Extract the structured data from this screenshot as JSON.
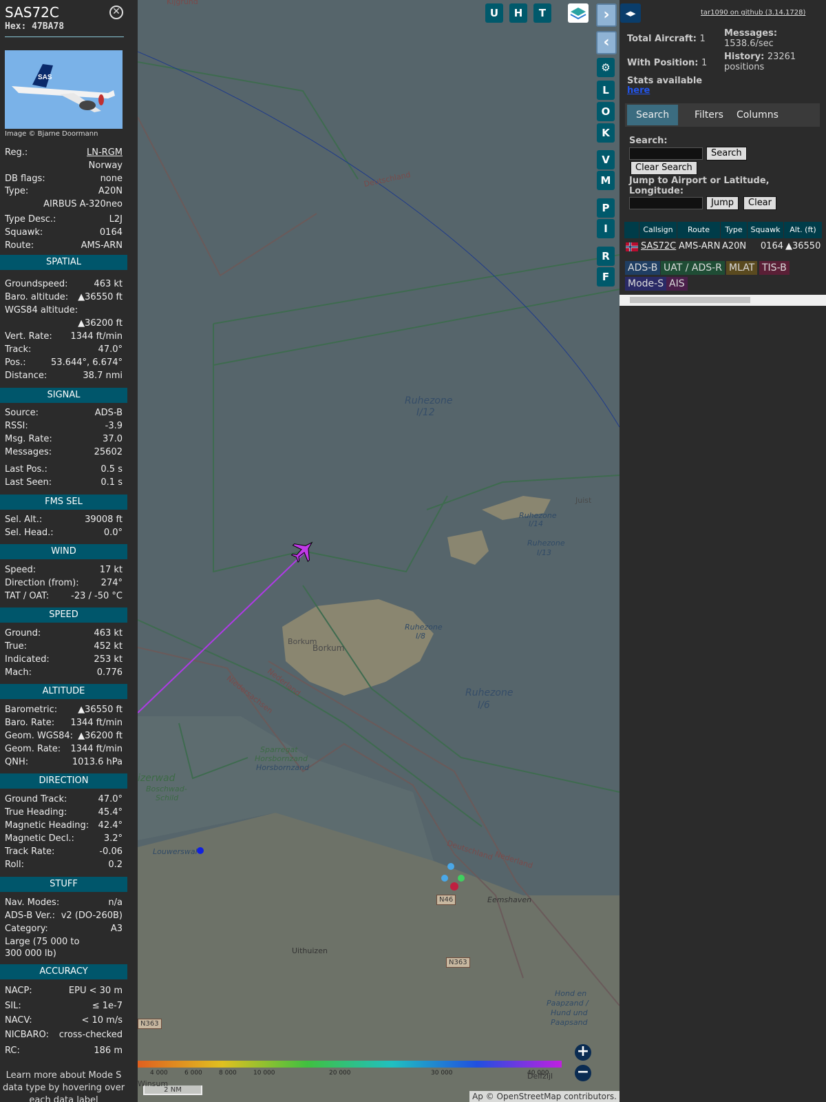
{
  "selected": {
    "callsign": "SAS72C",
    "hex_label": "Hex:",
    "hex": "47BA78",
    "image_credit": "Image © Bjarne Doormann",
    "photo_text": "SAS"
  },
  "details": [
    {
      "k": "Reg.:",
      "v": "LN-RGM"
    },
    {
      "k": "",
      "v": "Norway"
    },
    {
      "k": "DB flags:",
      "v": "none"
    },
    {
      "k": "Type:",
      "v": "A20N"
    },
    {
      "k": "",
      "v": "AIRBUS A-320neo"
    },
    {
      "k": "Type Desc.:",
      "v": "L2J"
    },
    {
      "k": "Squawk:",
      "v": "0164"
    },
    {
      "k": "Route:",
      "v": "AMS-ARN"
    }
  ],
  "sections": {
    "spatial": "SPATIAL",
    "signal": "SIGNAL",
    "fms": "FMS SEL",
    "wind": "WIND",
    "speed": "SPEED",
    "altitude": "ALTITUDE",
    "direction": "DIRECTION",
    "stuff": "STUFF",
    "accuracy": "ACCURACY"
  },
  "spatial": [
    {
      "k": "Groundspeed:",
      "v": "463 kt"
    },
    {
      "k": "Baro. altitude:",
      "v": "▲36550 ft"
    },
    {
      "k": "WGS84 altitude:",
      "v": ""
    },
    {
      "k": "",
      "v": "▲36200 ft"
    },
    {
      "k": "Vert. Rate:",
      "v": "1344 ft/min"
    },
    {
      "k": "Track:",
      "v": "47.0°"
    },
    {
      "k": "Pos.:",
      "v": "53.644°, 6.674°"
    },
    {
      "k": "Distance:",
      "v": "38.7 nmi"
    }
  ],
  "signal": [
    {
      "k": "Source:",
      "v": "ADS-B"
    },
    {
      "k": "RSSI:",
      "v": "-3.9"
    },
    {
      "k": "Msg. Rate:",
      "v": "37.0"
    },
    {
      "k": "Messages:",
      "v": "25602"
    },
    {
      "k": "Last Pos.:",
      "v": "0.5 s"
    },
    {
      "k": "Last Seen:",
      "v": "0.1 s"
    }
  ],
  "fms": [
    {
      "k": "Sel. Alt.:",
      "v": "39008 ft"
    },
    {
      "k": "Sel. Head.:",
      "v": "0.0°"
    }
  ],
  "wind": [
    {
      "k": "Speed:",
      "v": "17 kt"
    },
    {
      "k": "Direction (from):",
      "v": "274°"
    },
    {
      "k": "TAT / OAT:",
      "v": "-23 / -50 °C"
    }
  ],
  "speed": [
    {
      "k": "Ground:",
      "v": "463 kt"
    },
    {
      "k": "True:",
      "v": "452 kt"
    },
    {
      "k": "Indicated:",
      "v": "253 kt"
    },
    {
      "k": "Mach:",
      "v": "0.776"
    }
  ],
  "altitude": [
    {
      "k": "Barometric:",
      "v": "▲36550 ft"
    },
    {
      "k": "Baro. Rate:",
      "v": "1344 ft/min"
    },
    {
      "k": "Geom. WGS84:",
      "v": "▲36200 ft"
    },
    {
      "k": "Geom. Rate:",
      "v": "1344 ft/min"
    },
    {
      "k": "QNH:",
      "v": "1013.6 hPa"
    }
  ],
  "direction": [
    {
      "k": "Ground Track:",
      "v": "47.0°"
    },
    {
      "k": "True Heading:",
      "v": "45.4°"
    },
    {
      "k": "Magnetic Heading:",
      "v": "42.4°"
    },
    {
      "k": "Magnetic Decl.:",
      "v": "3.2°"
    },
    {
      "k": "Track Rate:",
      "v": "-0.06"
    },
    {
      "k": "Roll:",
      "v": "0.2"
    }
  ],
  "stuff": [
    {
      "k": "Nav. Modes:",
      "v": "n/a"
    },
    {
      "k": "ADS-B Ver.:",
      "v": "v2 (DO-260B)"
    },
    {
      "k": "Category:",
      "v": "A3"
    },
    {
      "k": "Large (75 000 to",
      "v": ""
    },
    {
      "k": "300 000 lb)",
      "v": ""
    }
  ],
  "accuracy": [
    {
      "k": "NACP:",
      "v": "EPU < 30 m"
    },
    {
      "k": "SIL:",
      "v": "≤ 1e-7"
    },
    {
      "k": "NACV:",
      "v": "< 10 m/s"
    },
    {
      "k": "NICBARO:",
      "v": "cross-checked"
    },
    {
      "k": "RC:",
      "v": "186 m"
    }
  ],
  "learn_more": "Learn more about Mode S data type by hovering over each data label",
  "map": {
    "buttons_top": [
      "U",
      "H",
      "T"
    ],
    "side_buttons": [
      "L",
      "O",
      "K",
      "V",
      "M",
      "P",
      "I",
      "R",
      "F"
    ],
    "labels": {
      "ruhezone12": "Ruhezone",
      "ruhezone12b": "I/12",
      "ruhezone6": "Ruhezone",
      "ruhezone6b": "I/6",
      "ruhezone14": "Ruhezone",
      "ruhezone14b": "I/14",
      "ruhezone13": "Ruhezone",
      "ruhezone13b": "I/13",
      "ruhezone8": "Ruhezone",
      "ruhezone8b": "I/8",
      "borkum1": "Borkum",
      "borkum2": "Borkum",
      "juist": "Juist",
      "deutschland1": "Deutschland",
      "deutschland2": "Deutschland",
      "niedersachsen": "Niedersachsen",
      "nederland1": "Nederland",
      "nederland2": "Nederland",
      "sparregat": "Sparregat",
      "horsbornzand": "Horsbornzand",
      "horsbornzand2": "Horsbornzand",
      "boschwad": "Boschwad-",
      "schild": "Schild",
      "zerwad": "izerwad",
      "louwerswal": "Louwerswal",
      "uithuizen": "Uithuizen",
      "eemshaven": "Eemshaven",
      "delfzijl": "Delfzijl",
      "winsum": "Winsum",
      "hondpaap": "Hond en",
      "hondpaap2": "Paapzand /",
      "hondpaap3": "Hund und",
      "hondpaap4": "Paapsand",
      "n46": "N46",
      "n363a": "N363",
      "n363b": "N363",
      "top_label": "Kijgrund"
    },
    "scale_ticks": [
      "4 000",
      "6 000",
      "8 000",
      "10 000",
      "20 000",
      "30 000",
      "40 000"
    ],
    "scale_bar": "2 NM",
    "attribution_prefix": "Ap",
    "attribution": "© OpenStreetMap contributors."
  },
  "right": {
    "github": "tar1090 on github (3.14.1728)",
    "total_label": "Total Aircraft:",
    "total": "1",
    "position_label": "With Position:",
    "position": "1",
    "messages_label": "Messages:",
    "messages": "1538.6/sec",
    "history_label": "History:",
    "history": "23261 positions",
    "stats": "Stats available",
    "stats_link": "here",
    "tabs": [
      "Search",
      "Filters",
      "Columns"
    ],
    "search_label": "Search:",
    "search_btn": "Search",
    "clear_search_btn": "Clear Search",
    "jump_label": "Jump to Airport or Latitude, Longitude:",
    "jump_btn": "Jump",
    "clear_btn": "Clear",
    "columns": [
      "Callsign",
      "Route",
      "Type",
      "Squawk",
      "Alt. (ft)"
    ],
    "row": {
      "callsign": "SAS72C",
      "route": "AMS-ARN",
      "type": "A20N",
      "squawk": "0164",
      "alt": "▲36550"
    },
    "sources": [
      "ADS-B",
      "UAT / ADS-R",
      "MLAT",
      "TIS-B",
      "Mode-S",
      "AIS"
    ],
    "source_colors": [
      "#1f3e63",
      "#1f4d35",
      "#5a4a1f",
      "#5a1f36",
      "#2a2a66",
      "#4a1f4a"
    ]
  }
}
